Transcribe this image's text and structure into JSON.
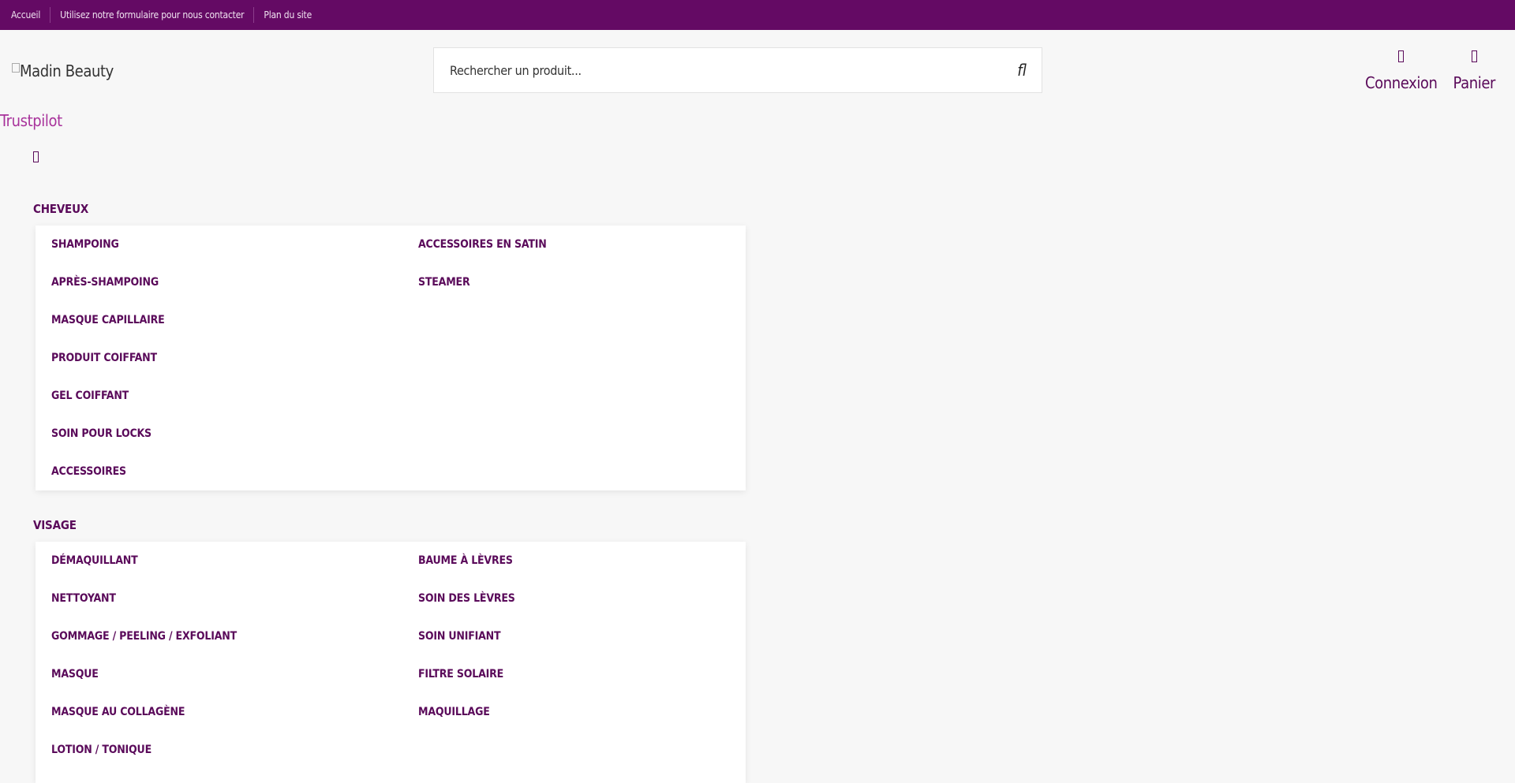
{
  "topbar": {
    "links": [
      "Accueil",
      "Utilisez notre formulaire pour nous contacter",
      "Plan du site"
    ]
  },
  "header": {
    "logo_alt": "Madin Beauty",
    "search_placeholder": "Rechercher un produit...",
    "search_button_glyph": "fl",
    "login_label": "Connexion",
    "cart_label": "Panier",
    "trustpilot": "Trustpilot"
  },
  "colors": {
    "brand": "#640a64",
    "text": "#5a0a5a",
    "accent": "#a8329b"
  },
  "menu": {
    "cheveux": {
      "title": "CHEVEUX",
      "left": [
        "SHAMPOING",
        "APRÈS-SHAMPOING",
        "MASQUE CAPILLAIRE",
        "PRODUIT COIFFANT",
        "GEL COIFFANT",
        "SOIN POUR LOCKS",
        "ACCESSOIRES"
      ],
      "right": [
        "ACCESSOIRES EN SATIN",
        "STEAMER"
      ]
    },
    "visage": {
      "title": "VISAGE",
      "left": [
        "DÉMAQUILLANT",
        "NETTOYANT",
        "GOMMAGE / PEELING / EXFOLIANT",
        "MASQUE",
        "MASQUE AU COLLAGÈNE",
        "LOTION / TONIQUE"
      ],
      "right": [
        "BAUME À LÈVRES",
        "SOIN DES LÈVRES",
        "SOIN UNIFIANT",
        "FILTRE SOLAIRE",
        "MAQUILLAGE"
      ]
    }
  }
}
